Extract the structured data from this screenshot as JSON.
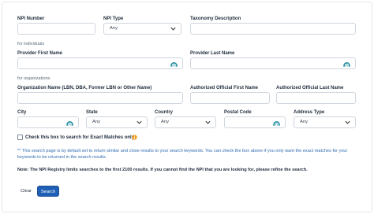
{
  "row1": {
    "npi_number_label": "NPI Number",
    "npi_type_label": "NPI Type",
    "npi_type_value": "Any",
    "taxonomy_label": "Taxonomy Description"
  },
  "individuals": {
    "section_label": "for individuals",
    "first_name_label": "Provider First Name",
    "last_name_label": "Provider Last Name"
  },
  "organizations": {
    "section_label": "for organizations",
    "org_name_label": "Organization Name (LBN, DBA, Former LBN or Other Name)",
    "auth_first_label": "Authorized Official First Name",
    "auth_last_label": "Authorized Official Last Name"
  },
  "address": {
    "city_label": "City",
    "state_label": "State",
    "state_value": "Any",
    "country_label": "Country",
    "country_value": "Any",
    "postal_label": "Postal Code",
    "address_type_label": "Address Type",
    "address_type_value": "Any"
  },
  "exact_match": {
    "label": "Check this box to search for Exact Matches only",
    "checked": false
  },
  "notes": {
    "search_note": "** This search page is by default set to return similar and close results to your search keywords. You can check the box above if you only want the exact matches for your keywords to be returned in the search results.",
    "limit_note": "Note: The NPI Registry limits searches to the first 2100 results. If you cannot find the NPI that you are looking for, please refine the search."
  },
  "buttons": {
    "clear_label": "Clear",
    "search_label": "Search"
  },
  "icons": {
    "autocomplete": "npi-autocomplete-icon",
    "dropdown": "chevron-down-icon",
    "info": "info-icon"
  },
  "colors": {
    "primary": "#1f5fb4",
    "note_text": "#2f6bb0",
    "icon_teal": "#1f8a9e",
    "info_orange": "#f0a020"
  }
}
